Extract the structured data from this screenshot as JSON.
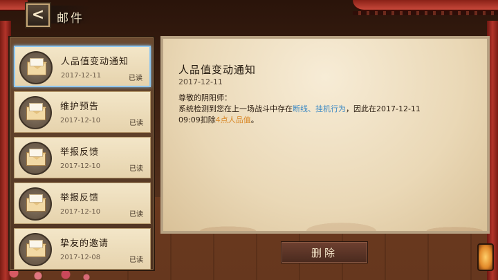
{
  "header": {
    "back_glyph": "<",
    "title": "邮件"
  },
  "mail_list": [
    {
      "title": "人品值变动通知",
      "date": "2017-12-11",
      "status": "已读",
      "selected": true,
      "icon": "envelope-icon"
    },
    {
      "title": "维护预告",
      "date": "2017-12-10",
      "status": "已读",
      "selected": false,
      "icon": "envelope-icon"
    },
    {
      "title": "举报反馈",
      "date": "2017-12-10",
      "status": "已读",
      "selected": false,
      "icon": "envelope-icon"
    },
    {
      "title": "举报反馈",
      "date": "2017-12-10",
      "status": "已读",
      "selected": false,
      "icon": "envelope-icon"
    },
    {
      "title": "挚友的邀请",
      "date": "2017-12-08",
      "status": "已读",
      "selected": false,
      "icon": "envelope-icon"
    }
  ],
  "detail": {
    "title": "人品值变动通知",
    "date": "2017-12-11",
    "greeting": "尊敬的阴阳师：",
    "body_prefix": "系统检测到您在上一场战斗中存在",
    "body_hl1": "断线、挂机行为",
    "body_middle": "，因此在2017-12-11 09:09扣除",
    "body_hl2": "4点人品值",
    "body_suffix": "。"
  },
  "actions": {
    "delete_label": "删除"
  },
  "colors": {
    "highlight_blue": "#3d8ac4",
    "highlight_orange": "#d98a2a",
    "selected_border": "#8fc6ee"
  }
}
